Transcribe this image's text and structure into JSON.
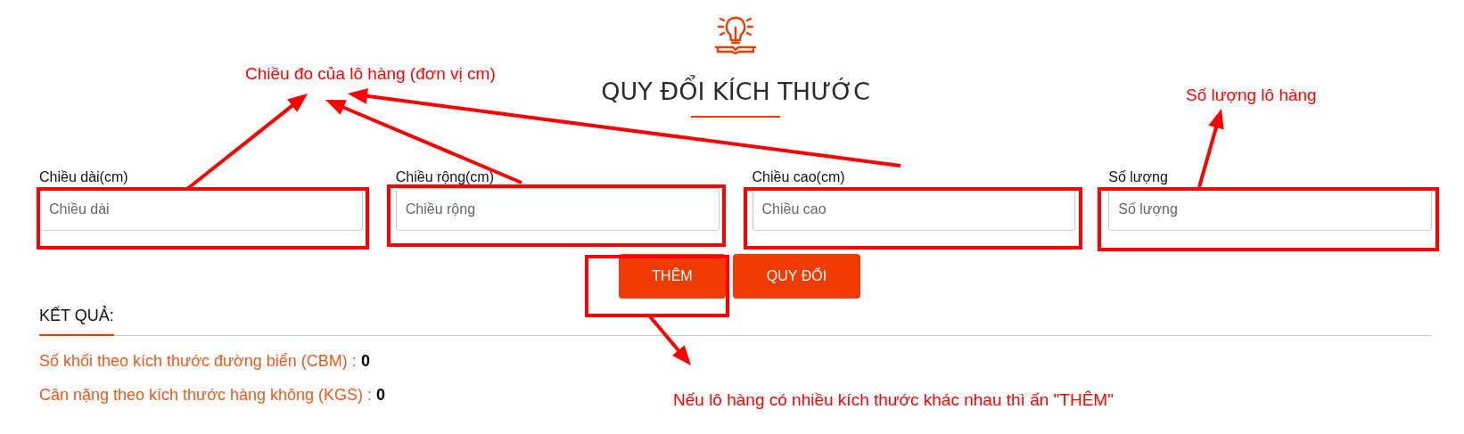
{
  "header": {
    "title": "QUY ĐỔI KÍCH THƯỚC"
  },
  "fields": [
    {
      "label": "Chiều dài(cm)",
      "placeholder": "Chiều dài"
    },
    {
      "label": "Chiều rộng(cm)",
      "placeholder": "Chiều rộng"
    },
    {
      "label": "Chiều cao(cm)",
      "placeholder": "Chiều cao"
    },
    {
      "label": "Số lượng",
      "placeholder": "Số lượng"
    }
  ],
  "buttons": [
    "THÊM",
    "QUY ĐỔI"
  ],
  "results": {
    "heading": "KẾT QUẢ:",
    "rows": [
      {
        "label": "Số khối theo kích thước đường biển (CBM) :",
        "value": "0"
      },
      {
        "label": "Cân nặng theo kích thước hàng không (KGS) :",
        "value": "0"
      }
    ]
  },
  "annotations": [
    "Chiều đo của lô hàng (đơn vị cm)",
    "Số lượng lô hàng",
    "Nếu lô hàng có nhiều kích thước khác nhau thì ấn \"THÊM\""
  ]
}
